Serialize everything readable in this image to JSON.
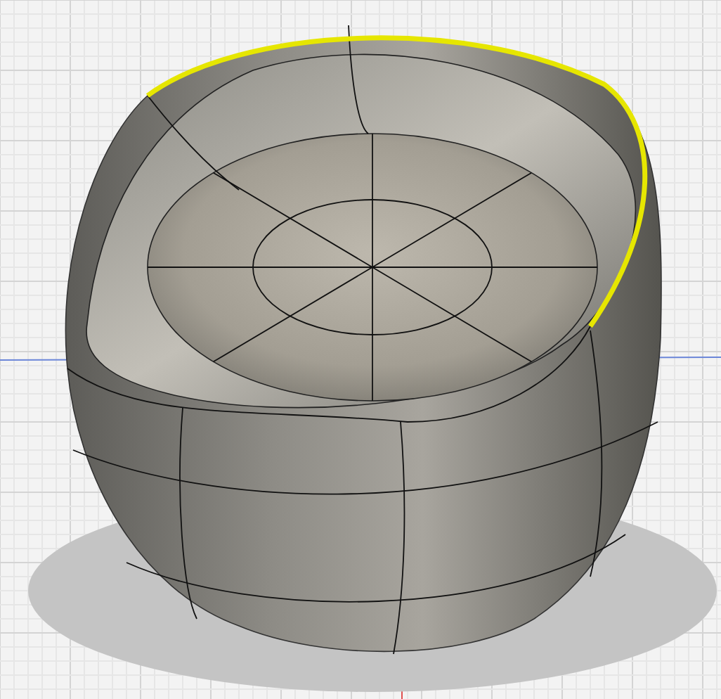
{
  "model": {
    "edge_selected": true
  }
}
